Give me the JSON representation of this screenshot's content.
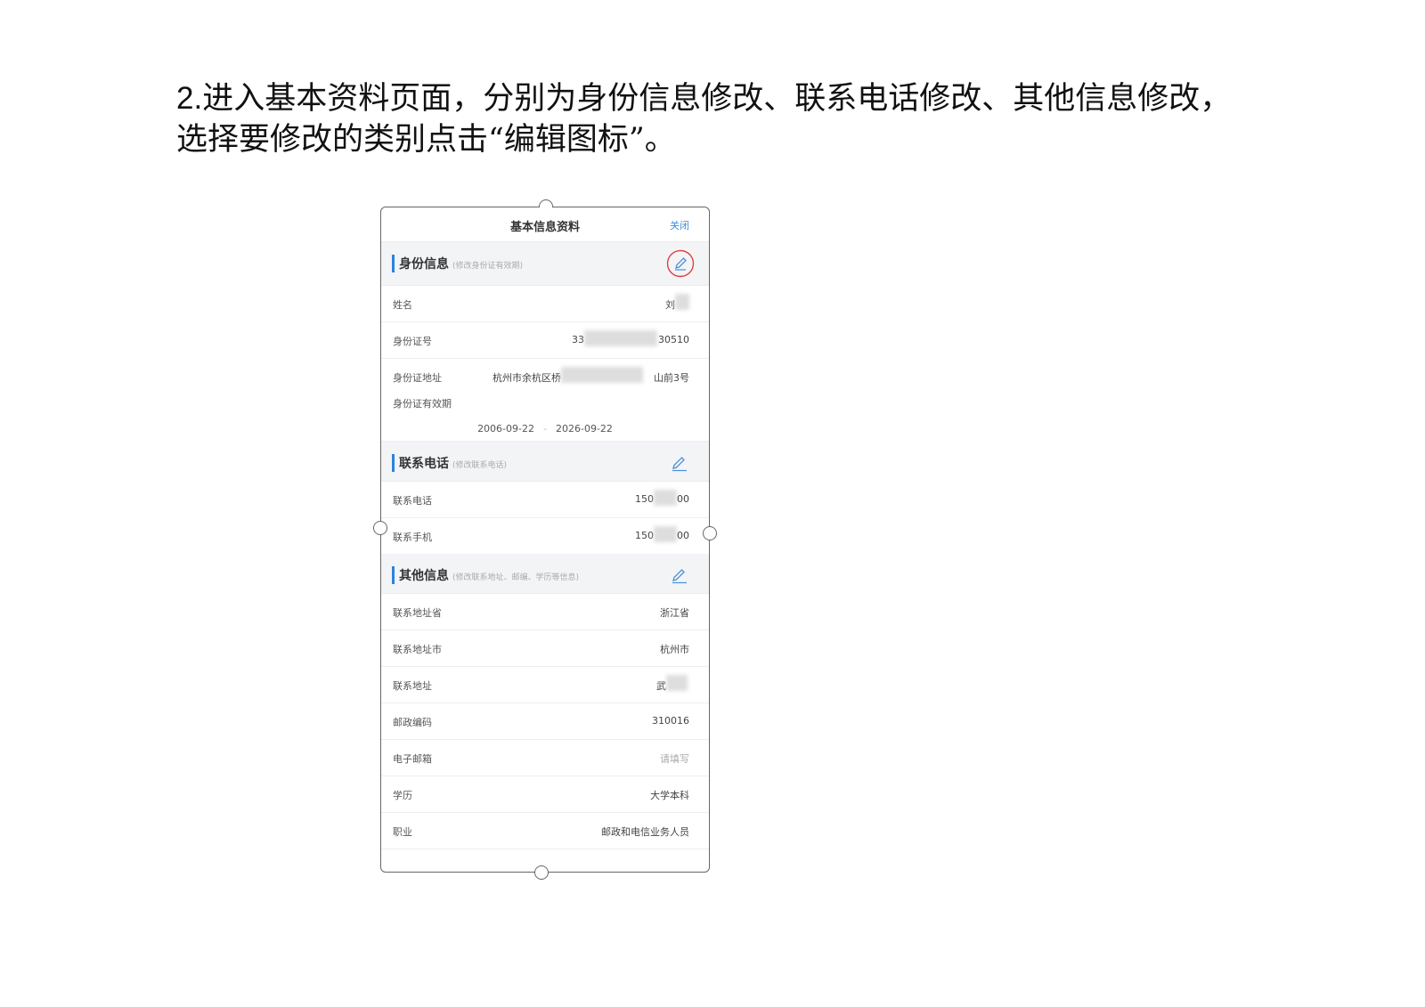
{
  "instruction": {
    "number": "2.",
    "text": "进入基本资料页面，分别为身份信息修改、联系电话修改、其他信息修改，选择要修改的类别点击“编辑图标”。"
  },
  "nav": {
    "title": "基本信息资料",
    "close": "关闭"
  },
  "identity": {
    "title": "身份信息",
    "hint": "(修改身份证有效期)",
    "icon": "edit-pencil-icon",
    "highlight_color": "#e04040",
    "rows": {
      "name_label": "姓名",
      "name_value": "刘",
      "idnum_label": "身份证号",
      "idnum_prefix": "33",
      "idnum_suffix": "30510",
      "addr_label": "身份证地址",
      "addr_prefix": "杭州市余杭区桥",
      "addr_suffix": "山前3号",
      "validity_label": "身份证有效期",
      "valid_from": "2006-09-22",
      "valid_to": "2026-09-22"
    }
  },
  "phone": {
    "title": "联系电话",
    "hint": "(修改联系电话)",
    "icon": "edit-pencil-icon",
    "rows": {
      "tel_label": "联系电话",
      "tel_prefix": "150",
      "tel_suffix": "00",
      "mobile_label": "联系手机",
      "mobile_prefix": "150",
      "mobile_suffix": "00"
    }
  },
  "other": {
    "title": "其他信息",
    "hint": "(修改联系地址、邮编、学历等信息)",
    "icon": "edit-pencil-icon",
    "rows": [
      {
        "label": "联系地址省",
        "value": "浙江省"
      },
      {
        "label": "联系地址市",
        "value": "杭州市"
      },
      {
        "label": "联系地址",
        "value": "武"
      },
      {
        "label": "邮政编码",
        "value": "310016"
      },
      {
        "label": "电子邮箱",
        "value": "请填写"
      },
      {
        "label": "学历",
        "value": "大学本科"
      },
      {
        "label": "职业",
        "value": "邮政和电信业务人员"
      }
    ]
  },
  "colors": {
    "accent": "#2c82de",
    "link": "#3b8fe0",
    "section_bg": "#f3f4f6"
  }
}
